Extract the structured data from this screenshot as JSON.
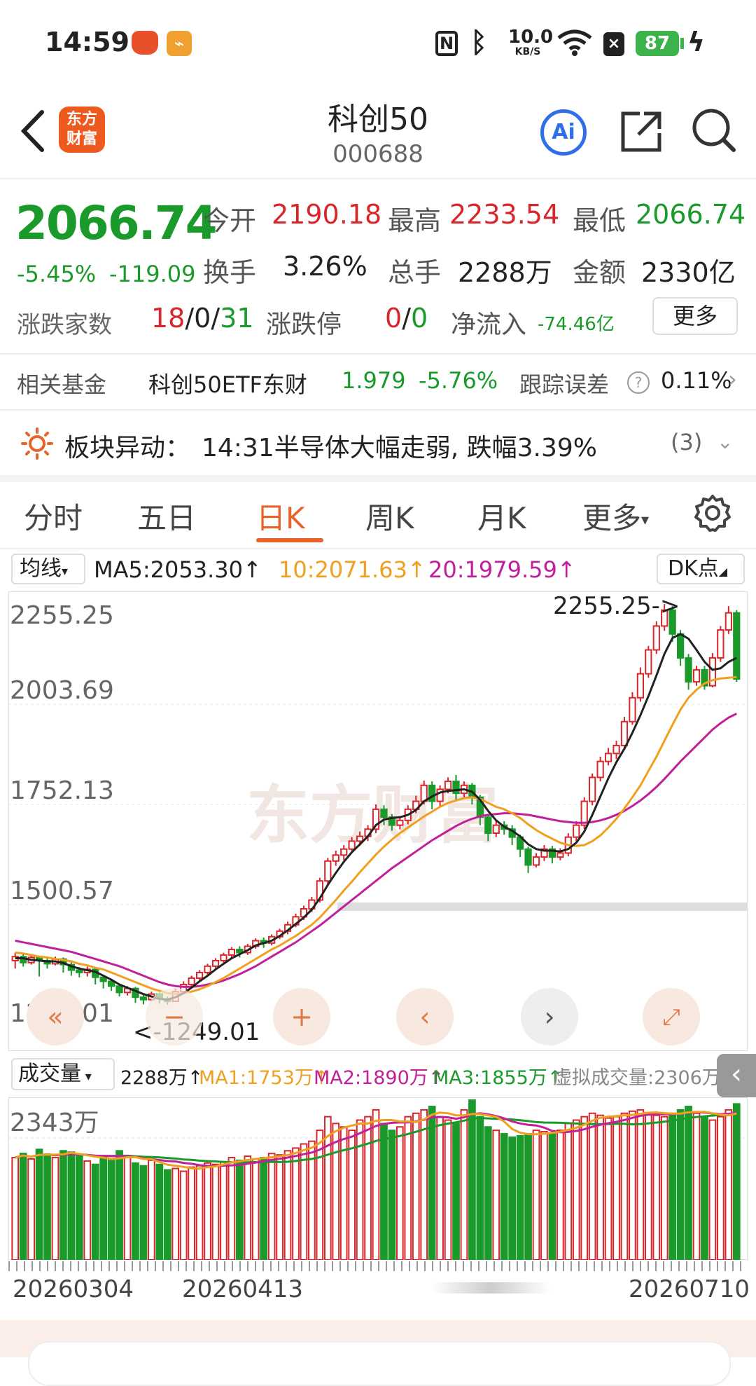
{
  "status_bar": {
    "time": "14:59",
    "net_speed_value": "10.0",
    "net_speed_unit": "KB/S",
    "battery": "87"
  },
  "header": {
    "title": "科创50",
    "code": "000688",
    "logo_line1": "东方",
    "logo_line2": "财富",
    "ai_label": "Ai"
  },
  "quote": {
    "price": "2066.74",
    "change_pct": "-5.45%",
    "change_abs": "-119.09",
    "open_label": "今开",
    "open": "2190.18",
    "high_label": "最高",
    "high": "2233.54",
    "low_label": "最低",
    "low": "2066.74",
    "turnover_label": "换手",
    "turnover": "3.26%",
    "volume_label": "总手",
    "volume": "2288万",
    "amount_label": "金额",
    "amount": "2330亿",
    "breadth_label": "涨跌家数",
    "up_count": "18",
    "flat_count": "0",
    "down_count": "31",
    "limit_label": "涨跌停",
    "limit_up": "0",
    "limit_down": "0",
    "netflow_label": "净流入",
    "netflow": "-74.46亿",
    "more_label": "更多"
  },
  "fund": {
    "label": "相关基金",
    "name": "科创50ETF东财",
    "price": "1.979",
    "change": "-5.76%",
    "track_label": "跟踪误差",
    "track_value": "0.11%"
  },
  "alert": {
    "label": "板块异动：",
    "text": "14:31半导体大幅走弱, 跌幅3.39%",
    "count": "(3)"
  },
  "tabs": [
    "分时",
    "五日",
    "日K",
    "周K",
    "月K",
    "更多"
  ],
  "active_tab": 2,
  "ma_bar": {
    "selector": "均线",
    "ma5": "MA5:2053.30",
    "ma10": "10:2071.63",
    "ma20": "20:1979.59",
    "dk_label": "DK点"
  },
  "vol_bar": {
    "selector": "成交量",
    "vol": "2288万",
    "ma1": "MA1:1753万",
    "ma2": "MA2:1890万",
    "ma3": "MA3:1855万",
    "virtual": "虚拟成交量:2306万"
  },
  "colors": {
    "up": "#d8262a",
    "down": "#1a9a2a",
    "ma5": "#222222",
    "ma10": "#f0a020",
    "ma20": "#c0209a",
    "accent": "#e8632a"
  },
  "chart_data": {
    "type": "candlestick",
    "y_ticks": [
      "2255.25",
      "2003.69",
      "1752.13",
      "1500.57",
      "1249.01"
    ],
    "ylim": [
      1249.01,
      2255.25
    ],
    "max_label": "2255.25->",
    "min_label": "<-1249.01",
    "watermark": "东方财富",
    "x_ticks": [
      "20260304",
      "20260413",
      "20260710"
    ],
    "volume_max_label": "2343万",
    "candles": [
      [
        1360,
        1370,
        1340,
        1380
      ],
      [
        1370,
        1355,
        1345,
        1378
      ],
      [
        1355,
        1368,
        1350,
        1375
      ],
      [
        1368,
        1360,
        1320,
        1372
      ],
      [
        1360,
        1352,
        1340,
        1366
      ],
      [
        1352,
        1364,
        1348,
        1370
      ],
      [
        1364,
        1350,
        1330,
        1368
      ],
      [
        1350,
        1336,
        1322,
        1356
      ],
      [
        1336,
        1330,
        1318,
        1344
      ],
      [
        1330,
        1338,
        1320,
        1345
      ],
      [
        1338,
        1318,
        1300,
        1342
      ],
      [
        1318,
        1308,
        1290,
        1324
      ],
      [
        1308,
        1296,
        1284,
        1312
      ],
      [
        1296,
        1280,
        1270,
        1302
      ],
      [
        1280,
        1290,
        1272,
        1296
      ],
      [
        1290,
        1268,
        1254,
        1294
      ],
      [
        1268,
        1262,
        1250,
        1275
      ],
      [
        1262,
        1276,
        1258,
        1282
      ],
      [
        1276,
        1264,
        1252,
        1280
      ],
      [
        1264,
        1258,
        1249,
        1270
      ],
      [
        1258,
        1282,
        1256,
        1290
      ],
      [
        1282,
        1300,
        1280,
        1308
      ],
      [
        1300,
        1316,
        1296,
        1322
      ],
      [
        1316,
        1330,
        1310,
        1336
      ],
      [
        1330,
        1346,
        1324,
        1352
      ],
      [
        1346,
        1360,
        1340,
        1366
      ],
      [
        1360,
        1374,
        1352,
        1380
      ],
      [
        1374,
        1388,
        1366,
        1394
      ],
      [
        1388,
        1380,
        1368,
        1396
      ],
      [
        1380,
        1396,
        1374,
        1402
      ],
      [
        1396,
        1410,
        1390,
        1416
      ],
      [
        1410,
        1404,
        1392,
        1418
      ],
      [
        1404,
        1420,
        1398,
        1426
      ],
      [
        1420,
        1434,
        1414,
        1440
      ],
      [
        1434,
        1450,
        1426,
        1458
      ],
      [
        1450,
        1470,
        1444,
        1478
      ],
      [
        1470,
        1490,
        1462,
        1498
      ],
      [
        1490,
        1512,
        1482,
        1520
      ],
      [
        1512,
        1560,
        1506,
        1568
      ],
      [
        1560,
        1610,
        1552,
        1618
      ],
      [
        1610,
        1625,
        1598,
        1636
      ],
      [
        1625,
        1640,
        1612,
        1650
      ],
      [
        1640,
        1660,
        1630,
        1670
      ],
      [
        1660,
        1672,
        1648,
        1684
      ],
      [
        1672,
        1690,
        1660,
        1700
      ],
      [
        1690,
        1740,
        1680,
        1752
      ],
      [
        1740,
        1720,
        1700,
        1750
      ],
      [
        1720,
        1700,
        1686,
        1728
      ],
      [
        1700,
        1712,
        1690,
        1722
      ],
      [
        1712,
        1740,
        1702,
        1750
      ],
      [
        1740,
        1760,
        1730,
        1774
      ],
      [
        1760,
        1800,
        1752,
        1812
      ],
      [
        1800,
        1760,
        1740,
        1810
      ],
      [
        1760,
        1790,
        1748,
        1800
      ],
      [
        1790,
        1810,
        1780,
        1820
      ],
      [
        1810,
        1780,
        1762,
        1826
      ],
      [
        1780,
        1800,
        1770,
        1810
      ],
      [
        1800,
        1770,
        1752,
        1806
      ],
      [
        1770,
        1720,
        1700,
        1776
      ],
      [
        1720,
        1680,
        1660,
        1726
      ],
      [
        1680,
        1700,
        1670,
        1712
      ],
      [
        1700,
        1690,
        1676,
        1710
      ],
      [
        1690,
        1670,
        1650,
        1700
      ],
      [
        1670,
        1640,
        1620,
        1676
      ],
      [
        1640,
        1600,
        1580,
        1646
      ],
      [
        1600,
        1620,
        1594,
        1630
      ],
      [
        1620,
        1640,
        1610,
        1650
      ],
      [
        1640,
        1620,
        1604,
        1648
      ],
      [
        1620,
        1630,
        1612,
        1642
      ],
      [
        1630,
        1670,
        1622,
        1680
      ],
      [
        1670,
        1700,
        1660,
        1710
      ],
      [
        1700,
        1760,
        1690,
        1770
      ],
      [
        1760,
        1820,
        1750,
        1830
      ],
      [
        1820,
        1860,
        1810,
        1872
      ],
      [
        1860,
        1880,
        1850,
        1894
      ],
      [
        1880,
        1900,
        1866,
        1912
      ],
      [
        1900,
        1960,
        1890,
        1972
      ],
      [
        1960,
        2020,
        1952,
        2034
      ],
      [
        2020,
        2080,
        2010,
        2096
      ],
      [
        2080,
        2140,
        2070,
        2150
      ],
      [
        2140,
        2200,
        2130,
        2212
      ],
      [
        2200,
        2240,
        2188,
        2255
      ],
      [
        2240,
        2180,
        2160,
        2250
      ],
      [
        2180,
        2120,
        2100,
        2190
      ],
      [
        2120,
        2060,
        2040,
        2130
      ],
      [
        2060,
        2090,
        2050,
        2100
      ],
      [
        2090,
        2050,
        2040,
        2100
      ],
      [
        2050,
        2120,
        2046,
        2132
      ],
      [
        2120,
        2190,
        2110,
        2200
      ],
      [
        2190,
        2233,
        2180,
        2250
      ],
      [
        2233,
        2067,
        2060,
        2240
      ]
    ],
    "ma5": [
      1366,
      1366,
      1362,
      1360,
      1358,
      1358,
      1354,
      1346,
      1340,
      1336,
      1332,
      1322,
      1312,
      1300,
      1292,
      1284,
      1276,
      1270,
      1264,
      1262,
      1268,
      1278,
      1292,
      1308,
      1322,
      1338,
      1352,
      1366,
      1376,
      1386,
      1398,
      1404,
      1410,
      1422,
      1436,
      1452,
      1468,
      1488,
      1516,
      1550,
      1580,
      1608,
      1632,
      1652,
      1672,
      1700,
      1714,
      1718,
      1720,
      1726,
      1738,
      1760,
      1772,
      1782,
      1786,
      1788,
      1790,
      1784,
      1764,
      1736,
      1712,
      1696,
      1686,
      1672,
      1652,
      1640,
      1636,
      1636,
      1634,
      1640,
      1656,
      1684,
      1726,
      1772,
      1818,
      1858,
      1892,
      1932,
      1976,
      2024,
      2076,
      2130,
      2170,
      2180,
      2168,
      2140,
      2110,
      2090,
      2094,
      2110,
      2120
    ],
    "ma10": [
      1380,
      1378,
      1374,
      1370,
      1368,
      1364,
      1362,
      1358,
      1352,
      1348,
      1342,
      1338,
      1330,
      1322,
      1314,
      1306,
      1298,
      1290,
      1284,
      1278,
      1276,
      1278,
      1282,
      1288,
      1296,
      1306,
      1316,
      1328,
      1340,
      1352,
      1364,
      1376,
      1388,
      1398,
      1410,
      1422,
      1436,
      1450,
      1468,
      1490,
      1512,
      1536,
      1558,
      1582,
      1604,
      1626,
      1646,
      1664,
      1680,
      1694,
      1708,
      1722,
      1734,
      1746,
      1756,
      1762,
      1768,
      1770,
      1766,
      1756,
      1746,
      1740,
      1730,
      1718,
      1702,
      1688,
      1676,
      1666,
      1656,
      1650,
      1648,
      1650,
      1660,
      1674,
      1694,
      1716,
      1742,
      1770,
      1800,
      1836,
      1872,
      1912,
      1952,
      1990,
      2020,
      2040,
      2056,
      2064,
      2068,
      2070,
      2072
    ],
    "ma20": [
      1410,
      1406,
      1402,
      1398,
      1394,
      1390,
      1386,
      1382,
      1376,
      1370,
      1364,
      1358,
      1352,
      1346,
      1338,
      1330,
      1322,
      1314,
      1306,
      1300,
      1296,
      1294,
      1294,
      1296,
      1300,
      1304,
      1310,
      1318,
      1326,
      1336,
      1346,
      1358,
      1370,
      1382,
      1394,
      1406,
      1420,
      1434,
      1448,
      1464,
      1480,
      1496,
      1512,
      1528,
      1544,
      1560,
      1576,
      1592,
      1606,
      1620,
      1634,
      1648,
      1662,
      1674,
      1686,
      1698,
      1708,
      1716,
      1722,
      1726,
      1728,
      1730,
      1730,
      1728,
      1726,
      1722,
      1718,
      1714,
      1710,
      1708,
      1706,
      1706,
      1708,
      1712,
      1718,
      1726,
      1736,
      1748,
      1762,
      1778,
      1796,
      1816,
      1838,
      1860,
      1880,
      1900,
      1920,
      1940,
      1956,
      1970,
      1980
    ],
    "volumes": [
      1500,
      1560,
      1480,
      1620,
      1550,
      1500,
      1600,
      1580,
      1540,
      1450,
      1400,
      1520,
      1480,
      1600,
      1520,
      1420,
      1380,
      1460,
      1400,
      1320,
      1340,
      1300,
      1360,
      1380,
      1420,
      1400,
      1440,
      1500,
      1460,
      1520,
      1480,
      1500,
      1560,
      1540,
      1600,
      1640,
      1700,
      1740,
      1900,
      2100,
      2000,
      1950,
      1900,
      2050,
      2100,
      2200,
      2000,
      1900,
      1950,
      2100,
      2150,
      2200,
      2250,
      2100,
      2050,
      2000,
      2200,
      2343,
      2100,
      1950,
      1900,
      1850,
      1800,
      1820,
      1850,
      1900,
      1880,
      1860,
      1900,
      2000,
      2050,
      2100,
      2150,
      2120,
      2080,
      2100,
      2150,
      2180,
      2200,
      2160,
      2120,
      2100,
      2150,
      2200,
      2250,
      2150,
      2100,
      2050,
      2100,
      2200,
      2288
    ]
  }
}
